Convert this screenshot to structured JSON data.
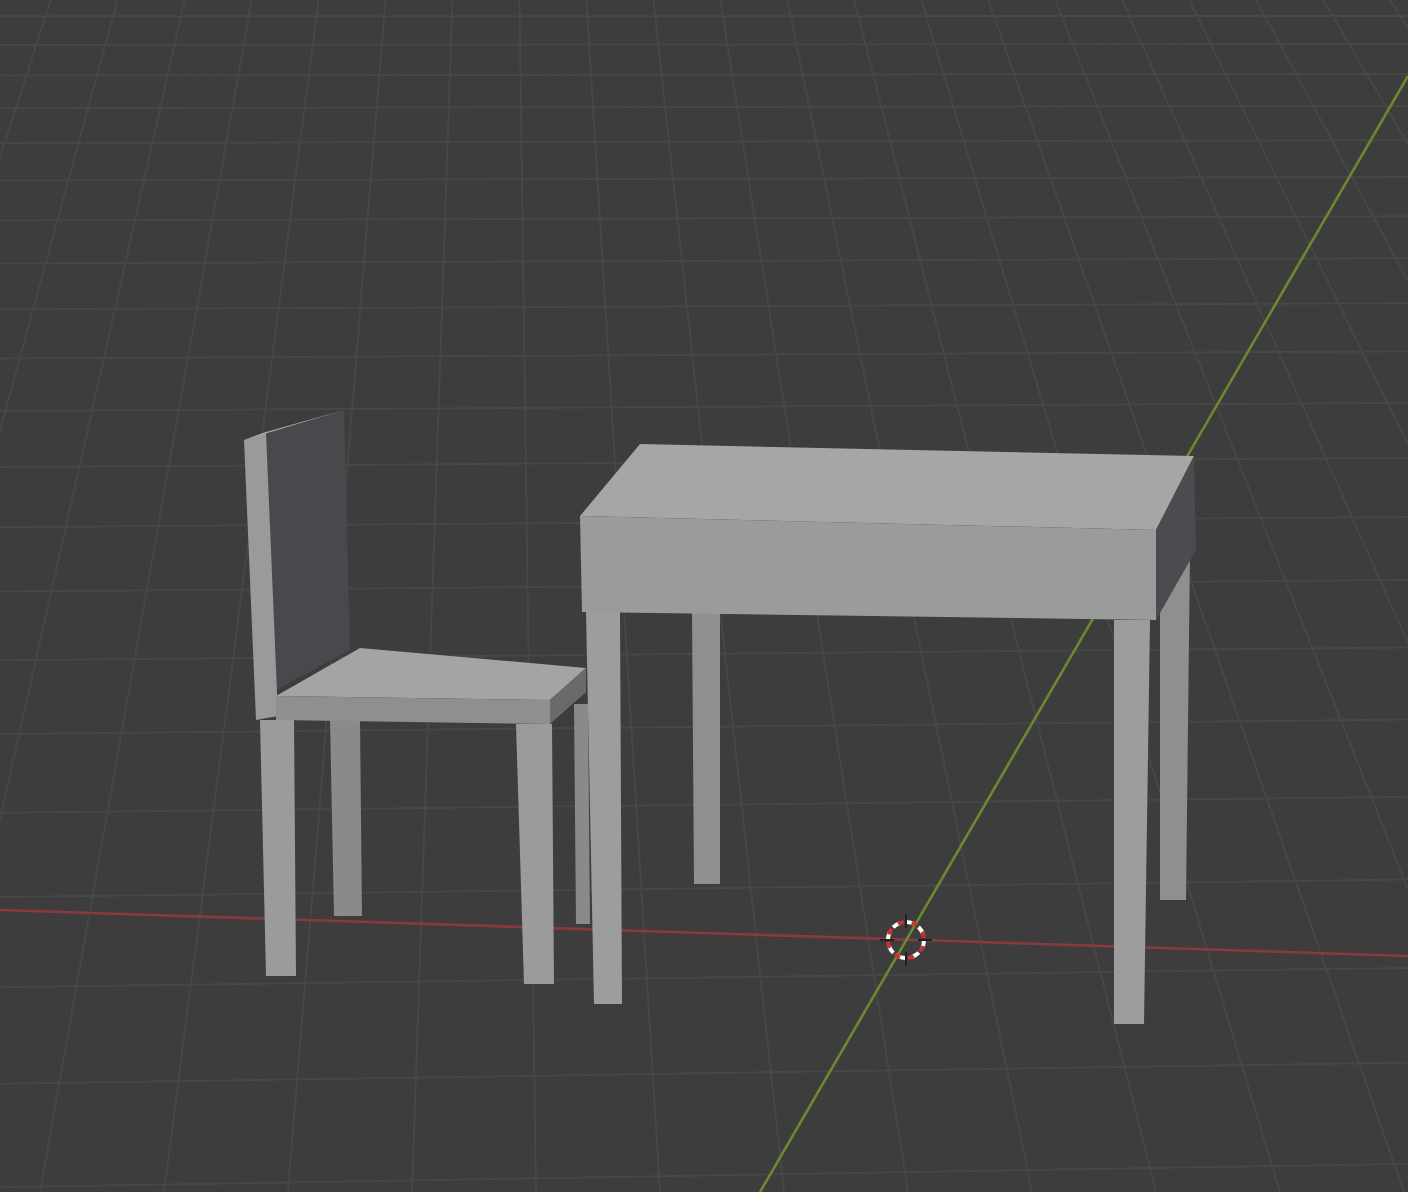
{
  "viewport": {
    "objects": [
      {
        "kind": "chair"
      },
      {
        "kind": "table"
      }
    ]
  }
}
